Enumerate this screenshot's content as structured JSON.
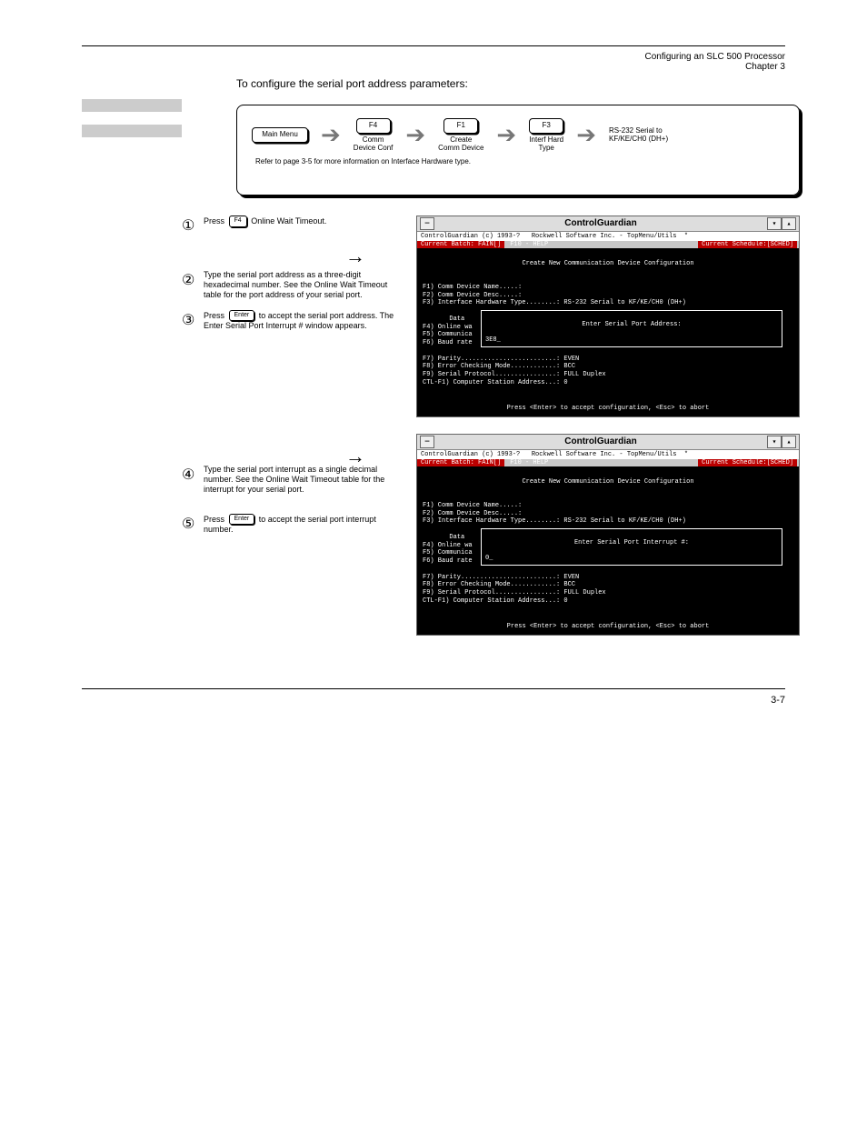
{
  "header": {
    "chapter_line1": "Configuring an SLC 500 Processor",
    "chapter_line2": "Chapter 3"
  },
  "section": {
    "intro": "To configure the serial port address parameters:",
    "nav": {
      "main_menu": "Main Menu",
      "f4": "F4",
      "f4_label": "Comm\nDevice Conf",
      "f1": "F1",
      "f1_label": "Create\nComm Device",
      "f3": "F3",
      "f3_label": "Interf Hard\nType",
      "hw_label": "RS-232 Serial to\nKF/KE/CH0 (DH+)",
      "sub": "Refer to page 3-5 for more information on Interface Hardware type."
    },
    "block1": {
      "step1_k": "F4",
      "step1_t": "Press          Online Wait Timeout.",
      "step2_t": "Type the serial port address as a three-digit hexadecimal number. See the Online Wait Timeout table for the port address of your serial port.",
      "step3_k": "Enter",
      "step3_t": "Press          to accept the serial port address. The Enter Serial Port Interrupt # window appears."
    },
    "block2": {
      "step4_t": "Type the serial port interrupt as a single decimal number. See the Online Wait Timeout table for the interrupt for your serial port.",
      "step5_k": "Enter",
      "step5_t": "Press          to accept the serial port interrupt number."
    }
  },
  "doswin": {
    "title": "ControlGuardian",
    "copyright": "ControlGuardian (c) 1993-?   Rockwell Software Inc. - TopMenu/Utils  *",
    "status_left": "Current Batch: FAIN[]",
    "status_mid": "F10 - HELP",
    "status_right": "Current Schedule:[SCHED]",
    "panel_title": "Create New Communication Device Configuration",
    "lines_top": "F1) Comm Device Name.....:\nF2) Comm Device Desc.....:\nF3) Interface Hardware Type........: RS-232 Serial to KF/KE/CH0 (DH+)",
    "left_block": "       Data\nF4) Online wa\nF5) Communica\nF6) Baud rate",
    "input1": "3E8_",
    "input2": "0_",
    "dlg1_title": "Enter Serial Port Address:",
    "dlg2_title": "Enter Serial Port Interrupt #:",
    "lines_bottom": "F7) Parity.........................: EVEN\nF8) Error Checking Mode............: BCC\nF9) Serial Protocol................: FULL Duplex\nCTL-F1) Computer Station Address...: 0",
    "footer": "Press <Enter> to accept configuration, <Esc> to abort"
  },
  "footer": {
    "page": "3-7"
  }
}
